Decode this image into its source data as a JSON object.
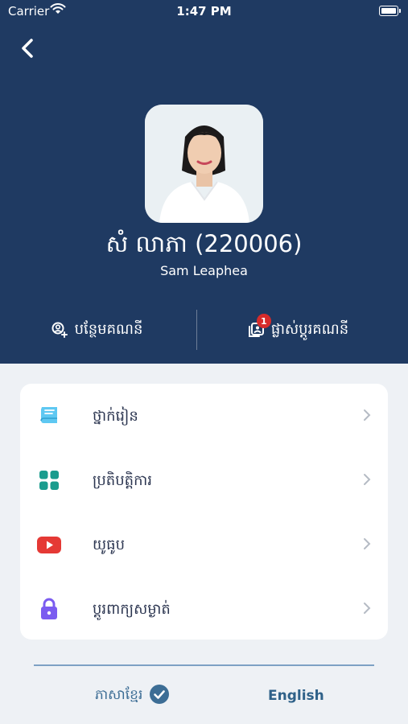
{
  "status_bar": {
    "carrier": "Carrier",
    "time": "1:47 PM"
  },
  "profile": {
    "name_kh": "សំ លាភា (220006)",
    "name_en": "Sam Leaphea"
  },
  "actions": {
    "add_account": "បន្ថែមគណនី",
    "switch_account": "ផ្លាស់ប្ដូរគណនី",
    "switch_badge": "1"
  },
  "menu": [
    {
      "label": "ថ្នាក់រៀន",
      "icon": "book-icon",
      "color": "#4fc3f7"
    },
    {
      "label": "ប្រតិបត្តិការ",
      "icon": "grid-icon",
      "color": "#1a9c8e"
    },
    {
      "label": "យូធូប",
      "icon": "youtube-icon",
      "color": "#e53935"
    },
    {
      "label": "ប្តូរពាក្យសម្ងាត់",
      "icon": "lock-icon",
      "color": "#7b5cf0"
    }
  ],
  "language": {
    "khmer": "ភាសាខ្មែរ",
    "english": "English",
    "selected": "khmer"
  },
  "colors": {
    "header": "#1f3a62",
    "accent": "#3c6d95"
  }
}
